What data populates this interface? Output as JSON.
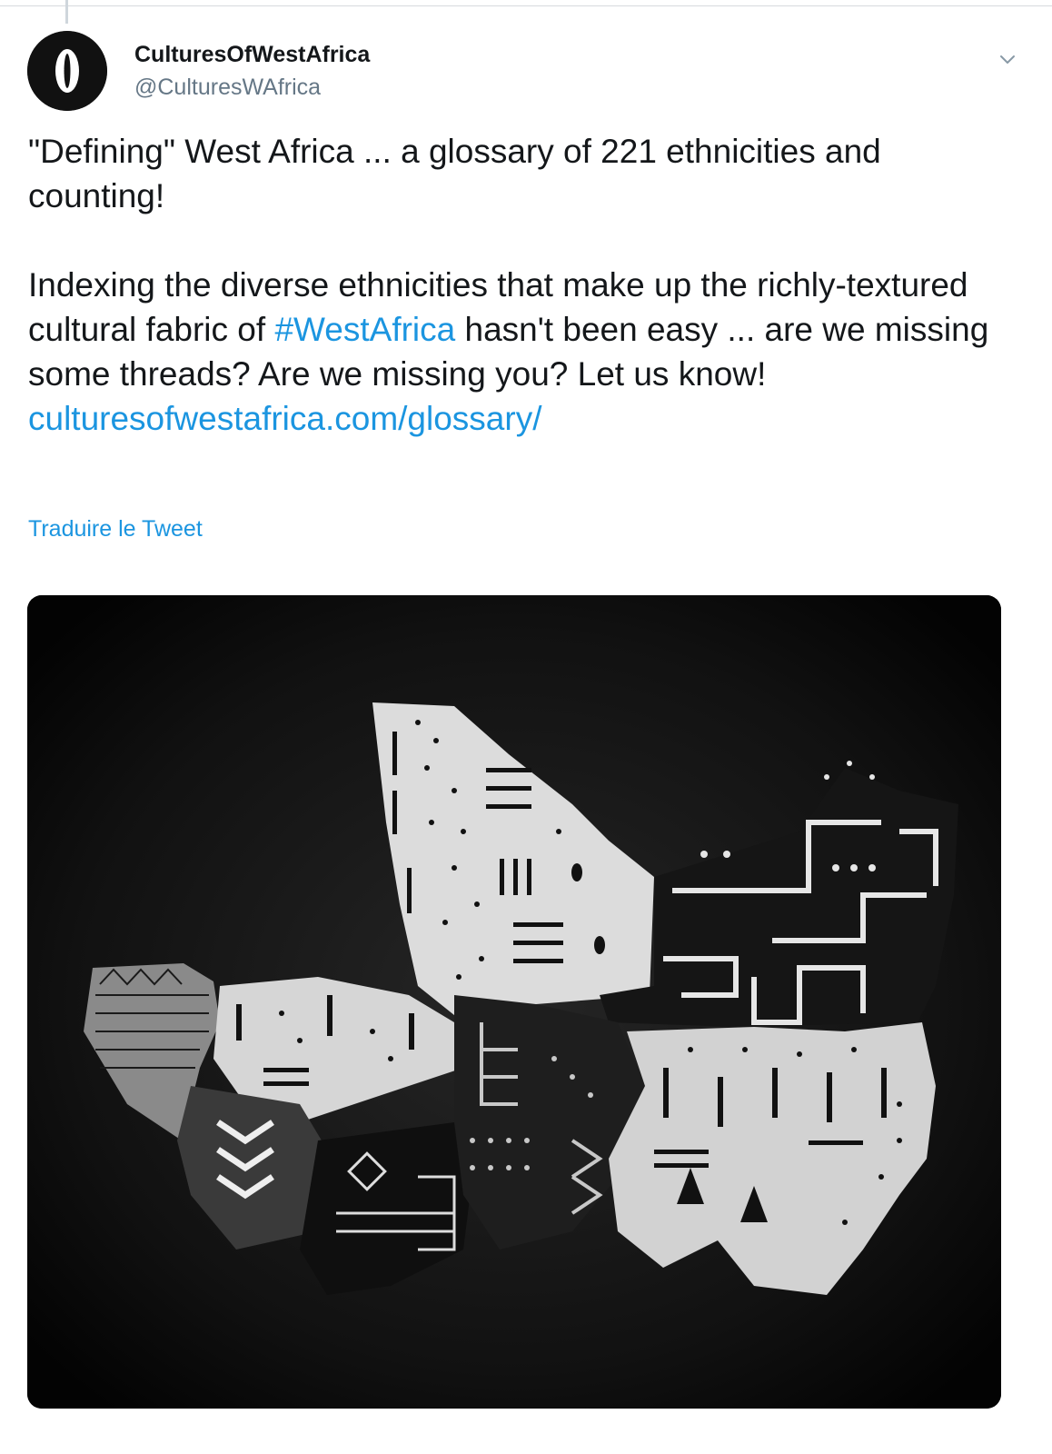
{
  "account": {
    "display_name": "CulturesOfWestAfrica",
    "handle": "@CulturesWAfrica"
  },
  "tweet": {
    "line1": "\"Defining\" West Africa ... a glossary of 221 ethnicities and counting!",
    "para2_before": "Indexing the diverse ethnicities that make up the richly-textured cultural fabric of ",
    "hashtag": "#WestAfrica",
    "para2_after": " hasn't been easy ... are we missing some threads? Are we missing you? Let us know!",
    "url": "culturesofwestafrica.com/glossary/",
    "translate_label": "Traduire le Tweet"
  },
  "icons": {
    "avatar": "cowrie-shell-logo",
    "menu": "chevron-down-icon"
  },
  "colors": {
    "link": "#1b95e0",
    "text": "#14171a",
    "secondary": "#657786"
  }
}
